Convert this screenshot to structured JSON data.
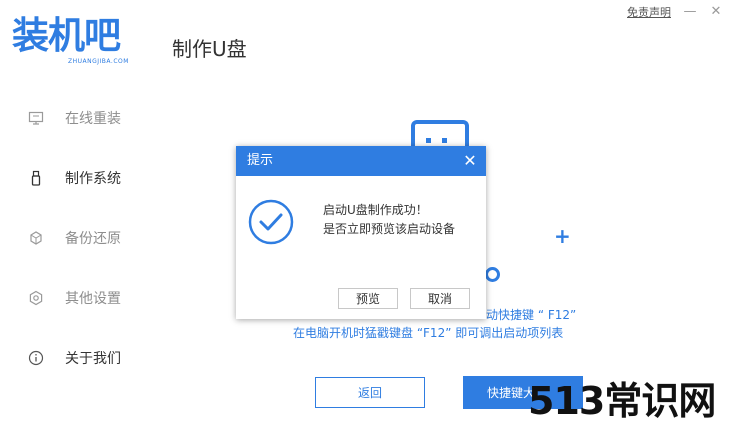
{
  "header": {
    "logo_text": "装机吧",
    "logo_subtext": "ZHUANGJIBA.COM",
    "page_title": "制作U盘",
    "disclaimer": "免责声明",
    "minimize": "—",
    "close": "✕"
  },
  "sidebar": {
    "items": [
      {
        "label": "在线重装",
        "icon": "monitor-icon",
        "active": false
      },
      {
        "label": "制作系统",
        "icon": "usb-drive-icon",
        "active": true
      },
      {
        "label": "备份还原",
        "icon": "backup-icon",
        "active": false
      },
      {
        "label": "其他设置",
        "icon": "gear-icon",
        "active": false
      },
      {
        "label": "关于我们",
        "icon": "info-icon",
        "active": false
      }
    ]
  },
  "main": {
    "hint_line1": "动快捷键 “ F12”",
    "hint_line2": "在电脑开机时猛戳键盘 “F12” 即可调出启动项列表",
    "back_button": "返回",
    "shortcut_button": "快捷键大"
  },
  "dialog": {
    "title": "提示",
    "close": "✕",
    "message_line1": "启动U盘制作成功！",
    "message_line2": "是否立即预览该启动设备",
    "preview_button": "预览",
    "cancel_button": "取消"
  },
  "watermark": "513常识网",
  "colors": {
    "accent": "#2f7de1",
    "text_dark": "#333333",
    "text_muted": "#8e8e8e"
  }
}
